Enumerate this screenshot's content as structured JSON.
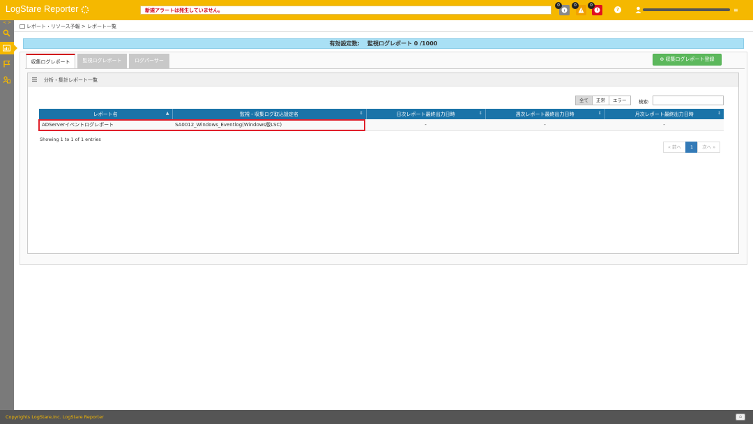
{
  "header": {
    "brand": "LogStare Reporter",
    "alert_message": "新規アラートは発生していません。",
    "badges": [
      "0",
      "0",
      "0"
    ],
    "help": "?",
    "menu_caret": "≡"
  },
  "sidebar": {
    "toggle": "< >",
    "items": [
      "search-icon",
      "report-icon",
      "flag-icon",
      "user-manage-icon"
    ]
  },
  "breadcrumb": {
    "path": "レポート・リソース予報 > レポート一覧"
  },
  "summary": {
    "label": "有効設定数:",
    "value": "監視ログレポート  0 /1000"
  },
  "tabs": [
    {
      "label": "収集ログレポート",
      "active": true
    },
    {
      "label": "監視ログレポート",
      "active": false
    },
    {
      "label": "ログパーサー",
      "active": false
    }
  ],
  "register_button": "⊕ 収集ログレポート登録",
  "panel": {
    "title": "分析・集計レポート一覧"
  },
  "filters": {
    "buttons": [
      "全て",
      "正常",
      "エラー"
    ],
    "selected": "全て",
    "search_label": "検索:",
    "search_value": ""
  },
  "table": {
    "columns": [
      "レポート名",
      "監視・収集ログ取込設定名",
      "日次レポート最終出力日時",
      "週次レポート最終出力日時",
      "月次レポート最終出力日時"
    ],
    "rows": [
      [
        "ADServerイベントログレポート",
        "SA0012_Windows_Eventlog(Windows版LSC)",
        "-",
        "-",
        "-"
      ]
    ]
  },
  "entries_info": "Showing 1 to 1 of 1 entries",
  "pagination": {
    "prev": "« 前へ",
    "current": "1",
    "next": "次へ »"
  },
  "footer": {
    "copyright": "Copyrights LogStare,Inc.  LogStare Reporter",
    "top_button": "⌂"
  },
  "colors": {
    "header": "#f5b800",
    "sidebar": "#7a7a7a",
    "summary": "#a9e0f5",
    "table_header": "#1a73a8",
    "register_button": "#5cb85c",
    "highlight": "#e0202b"
  }
}
